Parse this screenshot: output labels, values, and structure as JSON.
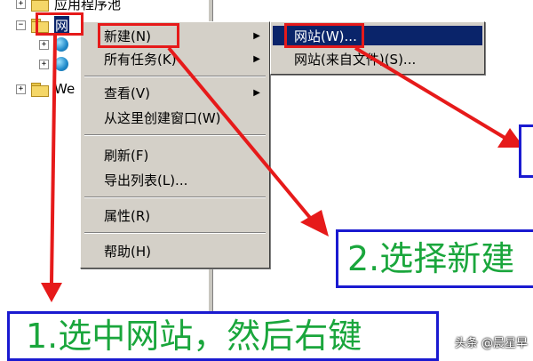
{
  "tree": {
    "items": [
      {
        "expander": "+",
        "label": "应用程序池"
      },
      {
        "expander": "−",
        "label": "网"
      },
      {
        "expander": "+",
        "label": ""
      },
      {
        "expander": "+",
        "label": ""
      },
      {
        "expander": "+",
        "label": "We"
      }
    ]
  },
  "context_menu": {
    "items": [
      {
        "label": "新建(N)",
        "submenu": true
      },
      {
        "label": "所有任务(K)",
        "submenu": true
      },
      {
        "label": "查看(V)",
        "submenu": true
      },
      {
        "label": "从这里创建窗口(W)",
        "submenu": false
      },
      {
        "label": "刷新(F)",
        "submenu": false
      },
      {
        "label": "导出列表(L)...",
        "submenu": false
      },
      {
        "label": "属性(R)",
        "submenu": false
      },
      {
        "label": "帮助(H)",
        "submenu": false
      }
    ],
    "arrow_glyph": "▶"
  },
  "submenu": {
    "items": [
      {
        "label": "网站(W)..."
      },
      {
        "label": "网站(来自文件)(S)..."
      }
    ]
  },
  "annotations": {
    "step1": "1.选中网站，然后右键",
    "step2": "2.选择新建",
    "highlight_color": "#e61a1a",
    "callout_border": "#1a1ad0",
    "callout_text_color": "#1aa63c"
  },
  "watermark": "头条 @晨星早"
}
